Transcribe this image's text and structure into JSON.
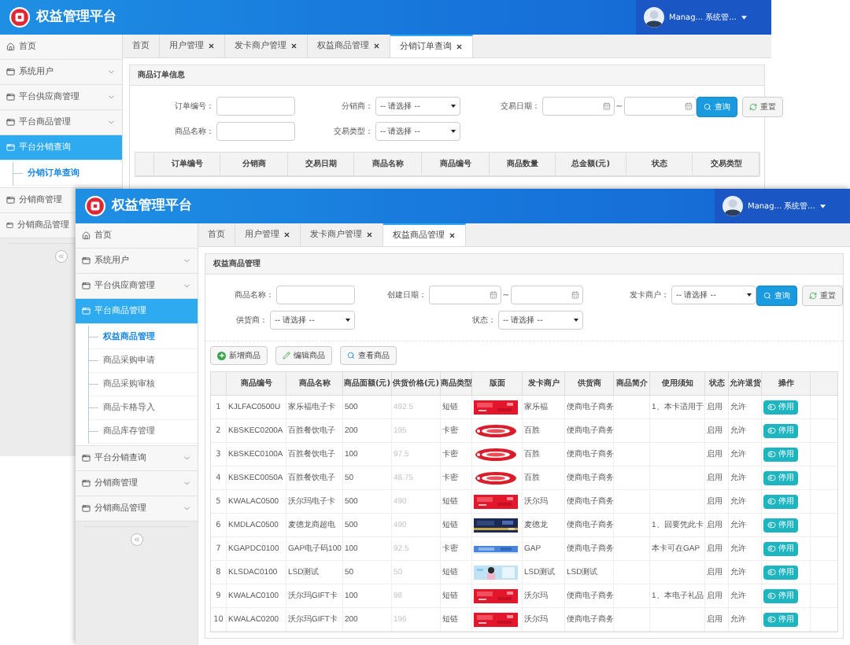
{
  "back_window": {
    "title": "权益管理平台",
    "user": {
      "name": "Manag...",
      "role": "系统管..."
    },
    "sidebar": [
      {
        "label": "首页",
        "kind": "home",
        "selected": false
      },
      {
        "label": "系统用户",
        "kind": "group",
        "selected": false,
        "expanded": false
      },
      {
        "label": "平台供应商管理",
        "kind": "group",
        "selected": false,
        "expanded": false
      },
      {
        "label": "平台商品管理",
        "kind": "group",
        "selected": false,
        "expanded": false
      },
      {
        "label": "平台分销查询",
        "kind": "group",
        "selected": true,
        "expanded": true,
        "children": [
          {
            "label": "分销订单查询",
            "selected": true
          }
        ]
      },
      {
        "label": "分销商管理",
        "kind": "group",
        "selected": false,
        "expanded": false
      },
      {
        "label": "分销商品管理",
        "kind": "group",
        "selected": false,
        "expanded": false
      }
    ],
    "tabs": [
      {
        "label": "首页",
        "closable": false,
        "selected": false
      },
      {
        "label": "用户管理",
        "closable": true,
        "selected": false
      },
      {
        "label": "发卡商户管理",
        "closable": true,
        "selected": false
      },
      {
        "label": "权益商品管理",
        "closable": true,
        "selected": false
      },
      {
        "label": "分销订单查询",
        "closable": true,
        "selected": true
      }
    ],
    "panel_title": "商品订单信息",
    "filters": [
      {
        "label": "订单编号：",
        "kind": "text"
      },
      {
        "label": "分销商：",
        "kind": "select",
        "value": "-- 请选择 --"
      },
      {
        "label": "交易日期：",
        "kind": "date_range",
        "separator": "~"
      },
      {
        "label": "商品名称：",
        "kind": "text"
      },
      {
        "label": "交易类型：",
        "kind": "select",
        "value": "-- 请选择 --"
      }
    ],
    "buttons": [
      {
        "label": "查询",
        "kind": "search"
      },
      {
        "label": "重置",
        "kind": "reset"
      }
    ],
    "table": {
      "columns": [
        "订单编号",
        "分销商",
        "交易日期",
        "商品名称",
        "商品编号",
        "商品数量",
        "总金额(元)",
        "状态",
        "交易类型"
      ]
    }
  },
  "front_window": {
    "title": "权益管理平台",
    "user": {
      "name": "Manag...",
      "role": "系统管..."
    },
    "sidebar": [
      {
        "label": "首页",
        "kind": "home",
        "selected": false
      },
      {
        "label": "系统用户",
        "kind": "group",
        "selected": false,
        "expanded": false
      },
      {
        "label": "平台供应商管理",
        "kind": "group",
        "selected": false,
        "expanded": false
      },
      {
        "label": "平台商品管理",
        "kind": "group",
        "selected": true,
        "expanded": true,
        "children": [
          {
            "label": "权益商品管理",
            "selected": true
          },
          {
            "label": "商品采购申请",
            "selected": false
          },
          {
            "label": "商品采购审核",
            "selected": false
          },
          {
            "label": "商品卡格导入",
            "selected": false
          },
          {
            "label": "商品库存管理",
            "selected": false
          }
        ]
      },
      {
        "label": "平台分销查询",
        "kind": "group",
        "selected": false,
        "expanded": false
      },
      {
        "label": "分销商管理",
        "kind": "group",
        "selected": false,
        "expanded": false
      },
      {
        "label": "分销商品管理",
        "kind": "group",
        "selected": false,
        "expanded": false
      }
    ],
    "tabs": [
      {
        "label": "首页",
        "closable": false,
        "selected": false
      },
      {
        "label": "用户管理",
        "closable": true,
        "selected": false
      },
      {
        "label": "发卡商户管理",
        "closable": true,
        "selected": false
      },
      {
        "label": "权益商品管理",
        "closable": true,
        "selected": true
      }
    ],
    "panel_title": "权益商品管理",
    "filters": [
      {
        "label": "商品名称：",
        "kind": "text"
      },
      {
        "label": "创建日期：",
        "kind": "date_range",
        "separator": "~"
      },
      {
        "label": "发卡商户：",
        "kind": "select",
        "value": "-- 请选择 --"
      },
      {
        "label": "供货商：",
        "kind": "select",
        "value": "-- 请选择 --"
      },
      {
        "label": "状态：",
        "kind": "select",
        "value": "-- 请选择 --"
      }
    ],
    "buttons": [
      {
        "label": "查询",
        "kind": "search"
      },
      {
        "label": "重置",
        "kind": "reset"
      }
    ],
    "actions": [
      {
        "label": "新增商品",
        "kind": "add"
      },
      {
        "label": "编辑商品",
        "kind": "edit"
      },
      {
        "label": "查看商品",
        "kind": "view"
      }
    ],
    "table": {
      "columns": [
        "商品编号",
        "商品名称",
        "商品面额(元)",
        "供货价格(元)",
        "商品类型",
        "版面",
        "发卡商户",
        "供货商",
        "商品简介",
        "使用须知",
        "状态",
        "允许退货",
        "操作"
      ],
      "rows": [
        {
          "index": "1",
          "cells": [
            "KJLFAC0500U",
            "家乐福电子卡",
            "500",
            "492.5",
            "短链",
            {
              "kind": "picture"
            },
            "家乐福",
            "便商电子商务",
            null,
            "1、本卡适用于",
            "启用",
            "允许",
            {
              "kind": "button",
              "label": "停用"
            }
          ]
        },
        {
          "index": "2",
          "cells": [
            "KBSKEC0200A",
            "百胜餐饮电子",
            "200",
            "195",
            "卡密",
            {
              "kind": "picture"
            },
            "百胜",
            "便商电子商务",
            null,
            null,
            "启用",
            "允许",
            {
              "kind": "button",
              "label": "停用"
            }
          ]
        },
        {
          "index": "3",
          "cells": [
            "KBSKEC0100A",
            "百胜餐饮电子",
            "100",
            "97.5",
            "卡密",
            {
              "kind": "picture"
            },
            "百胜",
            "便商电子商务",
            null,
            null,
            "启用",
            "允许",
            {
              "kind": "button",
              "label": "停用"
            }
          ]
        },
        {
          "index": "4",
          "cells": [
            "KBSKEC0050A",
            "百胜餐饮电子",
            "50",
            "48.75",
            "卡密",
            {
              "kind": "picture"
            },
            "百胜",
            "便商电子商务",
            null,
            null,
            "启用",
            "允许",
            {
              "kind": "button",
              "label": "停用"
            }
          ]
        },
        {
          "index": "5",
          "cells": [
            "KWALAC0500",
            "沃尔玛电子卡",
            "500",
            "490",
            "短链",
            {
              "kind": "picture"
            },
            "沃尔玛",
            "便商电子商务",
            null,
            null,
            "启用",
            "允许",
            {
              "kind": "button",
              "label": "停用"
            }
          ]
        },
        {
          "index": "6",
          "cells": [
            "KMDLAC0500",
            "麦德龙商超电",
            "500",
            "490",
            "短链",
            {
              "kind": "picture"
            },
            "麦德龙",
            "便商电子商务",
            null,
            "1、回要凭此卡",
            "启用",
            "允许",
            {
              "kind": "button",
              "label": "停用"
            }
          ]
        },
        {
          "index": "7",
          "cells": [
            "KGAPDC0100",
            "GAP电子码100",
            "100",
            "92.5",
            "卡密",
            {
              "kind": "picture"
            },
            "GAP",
            "便商电子商务",
            null,
            "本卡可在GAP",
            "启用",
            "允许",
            {
              "kind": "button",
              "label": "停用"
            }
          ]
        },
        {
          "index": "8",
          "cells": [
            "KLSDAC0100",
            "LSD测试",
            "50",
            "50",
            "短链",
            {
              "kind": "picture"
            },
            "LSD测试",
            "LSD测试",
            null,
            null,
            "启用",
            "允许",
            {
              "kind": "button",
              "label": "停用"
            }
          ]
        },
        {
          "index": "9",
          "cells": [
            "KWALAC0100",
            "沃尔玛GIFT卡",
            "100",
            "98",
            "短链",
            {
              "kind": "picture"
            },
            "沃尔玛",
            "便商电子商务",
            null,
            "1、本电子礼品",
            "启用",
            "允许",
            {
              "kind": "button",
              "label": "停用"
            }
          ]
        },
        {
          "index": "10",
          "cells": [
            "KWALAC0200",
            "沃尔玛GIFT卡",
            "200",
            "196",
            "短链",
            {
              "kind": "picture"
            },
            "沃尔玛",
            "便商电子商务",
            null,
            null,
            "启用",
            "允许",
            {
              "kind": "button",
              "label": "停用"
            }
          ]
        }
      ]
    }
  }
}
